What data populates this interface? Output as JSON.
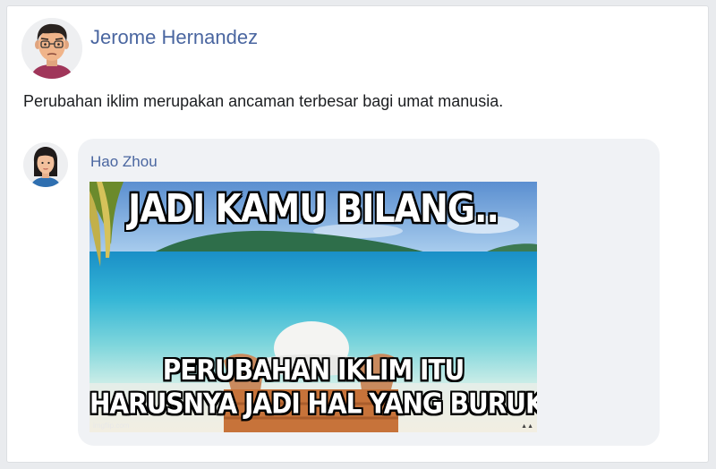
{
  "post": {
    "author_name": "Jerome Hernandez",
    "text": "Perubahan iklim merupakan ancaman terbesar bagi umat manusia."
  },
  "comment": {
    "author_name": "Hao Zhou",
    "meme": {
      "top_text": "JADI KAMU BILANG..",
      "bottom_line_1": "PERUBAHAN IKLIM ITU",
      "bottom_line_2": "HARUSNYA JADI HAL YANG BURUK",
      "watermark": "imgflip.com"
    }
  },
  "colors": {
    "name_link": "#4a66a0",
    "bubble_bg": "#f0f2f5",
    "card_bg": "#ffffff",
    "page_bg": "#e9ebee"
  },
  "icons": {
    "post_avatar": "man-avatar-icon",
    "comment_avatar": "woman-avatar-icon"
  }
}
